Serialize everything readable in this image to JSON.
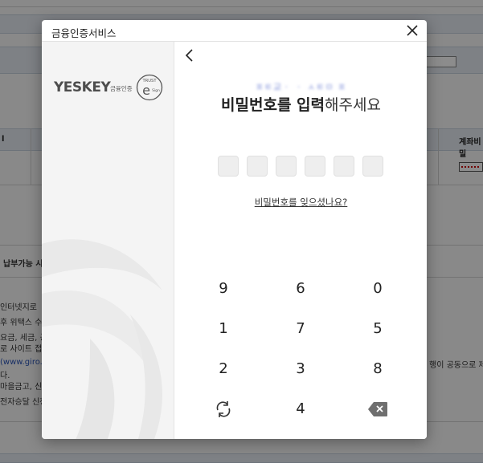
{
  "background": {
    "col_left_header": "l",
    "col_right_header": "계좌비밀",
    "row_label": "납부가능 시",
    "texts": [
      "인터넷지로",
      "후 위택스 수",
      "요금, 세금, 공",
      "로 사이트 접",
      "(www.giro.c",
      "다.",
      "마을금고, 신",
      "전자승달 신청"
    ],
    "right_text": "행이 공동으로 제"
  },
  "modal": {
    "title": "금융인증서비스",
    "brand": {
      "name": "YESKEY",
      "sub": "금융인증",
      "badge_top": "TRUST",
      "badge_letter": "e",
      "badge_side": "Sign"
    },
    "cert_name": "ㅍㅌ교ㆍ ㆍ ㅅㅌㅁ ㅍ",
    "prompt": {
      "bold": "비밀번호를 입력",
      "normal": "해주세요"
    },
    "pin_length": 6,
    "forgot_link": "비밀번호를 잊으셨나요?",
    "keypad": {
      "row1": [
        "9",
        "6",
        "0"
      ],
      "row2": [
        "1",
        "7",
        "5"
      ],
      "row3": [
        "2",
        "3",
        "8"
      ],
      "row4_middle": "4"
    }
  }
}
